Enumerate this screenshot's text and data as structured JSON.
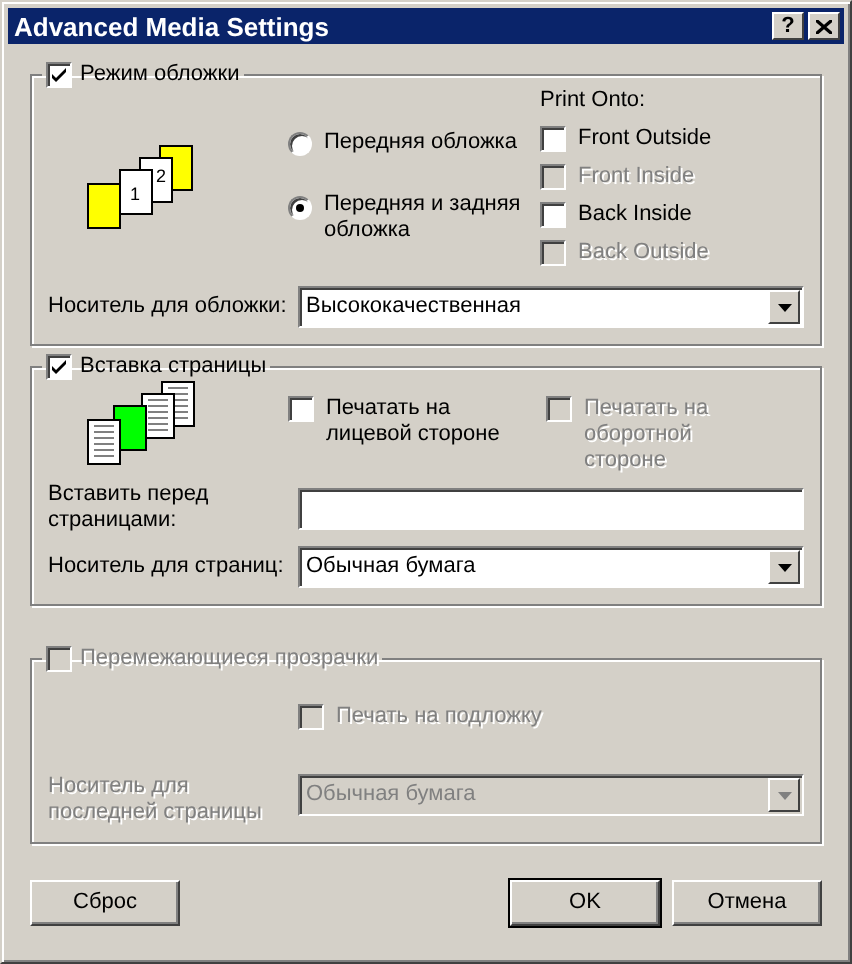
{
  "window": {
    "title": "Advanced Media Settings",
    "controls": [
      {
        "kind": "help",
        "label": "?"
      },
      {
        "kind": "close"
      }
    ]
  },
  "cover_group": {
    "label": "Режим обложки",
    "checked": true,
    "disabled": false,
    "icon_page_numbers": [
      "1",
      "2"
    ],
    "options": [
      {
        "label": "Передняя обложка",
        "selected": false
      },
      {
        "label": "Передняя и задняя обложка",
        "selected": true
      }
    ],
    "print_onto": {
      "label": "Print Onto:",
      "items": [
        {
          "label": "Front Outside",
          "checked": false,
          "disabled": false
        },
        {
          "label": "Front Inside",
          "checked": false,
          "disabled": true
        },
        {
          "label": "Back Inside",
          "checked": false,
          "disabled": false
        },
        {
          "label": "Back Outside",
          "checked": false,
          "disabled": true
        }
      ]
    },
    "media": {
      "label": "Носитель для обложки:",
      "value": "Высококачественная",
      "disabled": false
    }
  },
  "insert_group": {
    "label": "Вставка страницы",
    "checked": true,
    "disabled": false,
    "options": [
      {
        "label": "Печатать на лицевой стороне",
        "checked": false,
        "disabled": false
      },
      {
        "label": "Печатать на оборотной стороне",
        "checked": false,
        "disabled": true
      }
    ],
    "before": {
      "label": "Вставить перед страницами:"
    },
    "media": {
      "label": "Носитель для страниц:",
      "value": "Обычная бумага",
      "disabled": false
    }
  },
  "transparency_group": {
    "label": "Перемежающиеся прозрачки",
    "checked": false,
    "disabled": true,
    "option": {
      "label": "Печать на подложку",
      "checked": false,
      "disabled": true
    },
    "media": {
      "label": "Носитель для последней страницы",
      "value": "Обычная бумага",
      "disabled": true
    }
  },
  "buttons": [
    {
      "label": "Сброс",
      "default": false
    },
    {
      "label": "OK",
      "default": true
    },
    {
      "label": "Отмена",
      "default": false
    }
  ]
}
